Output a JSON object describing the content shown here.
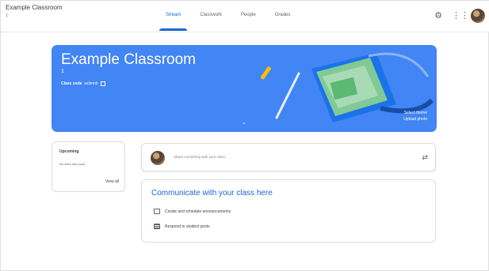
{
  "header": {
    "class_title": "Example Classroom",
    "class_section": "1",
    "tabs": [
      {
        "label": "Stream",
        "active": true
      },
      {
        "label": "Classwork",
        "active": false
      },
      {
        "label": "People",
        "active": false
      },
      {
        "label": "Grades",
        "active": false
      }
    ],
    "icons": [
      "gear-icon",
      "apps-grid-icon",
      "avatar"
    ]
  },
  "banner": {
    "title": "Example Classroom",
    "section": "1",
    "class_code_label": "Class code",
    "class_code_value": "wcbnnb",
    "upload_line1": "Select theme",
    "upload_line2": "Upload photo",
    "color": "#4285f4"
  },
  "upcoming": {
    "title": "Upcoming",
    "note": "No work due soon",
    "view_all": "View all"
  },
  "share": {
    "placeholder": "Share something with your class..."
  },
  "communicate": {
    "title": "Communicate with your class here",
    "items": [
      {
        "icon": "announcement-icon",
        "label": "Create and schedule announcements"
      },
      {
        "icon": "post-icon",
        "label": "Respond to student posts"
      }
    ]
  },
  "accent": "#1967d2"
}
